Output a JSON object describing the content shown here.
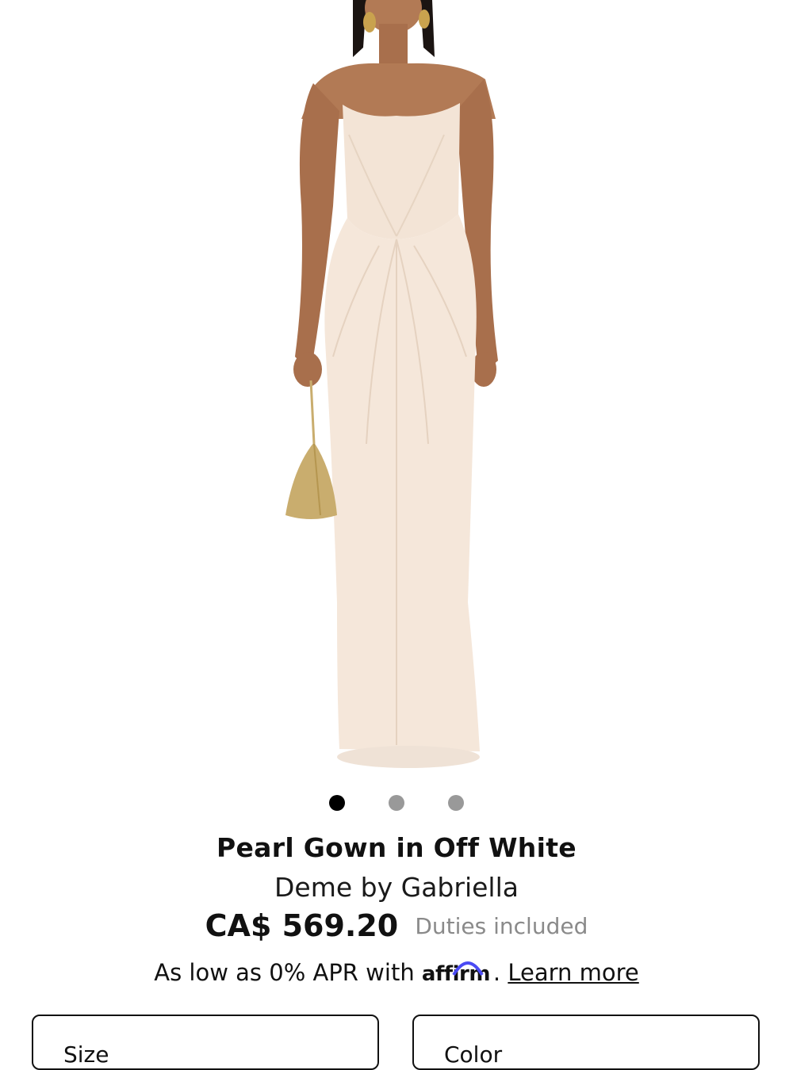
{
  "product": {
    "title": "Pearl Gown in Off White",
    "brand": "Deme by Gabriella",
    "price": "CA$ 569.20",
    "duties_note": "Duties included"
  },
  "carousel": {
    "dots": [
      {
        "active": true
      },
      {
        "active": false
      },
      {
        "active": false
      }
    ]
  },
  "financing": {
    "prefix": "As low as 0% APR with",
    "provider": "affirm",
    "link_label": "Learn more"
  },
  "selectors": {
    "size_label": "Size",
    "color_label": "Color"
  },
  "colors": {
    "dress": "#f3e4d6",
    "skin": "#b27a55",
    "bag": "#c9ad6e",
    "affirm_arc": "#4a4af4"
  }
}
